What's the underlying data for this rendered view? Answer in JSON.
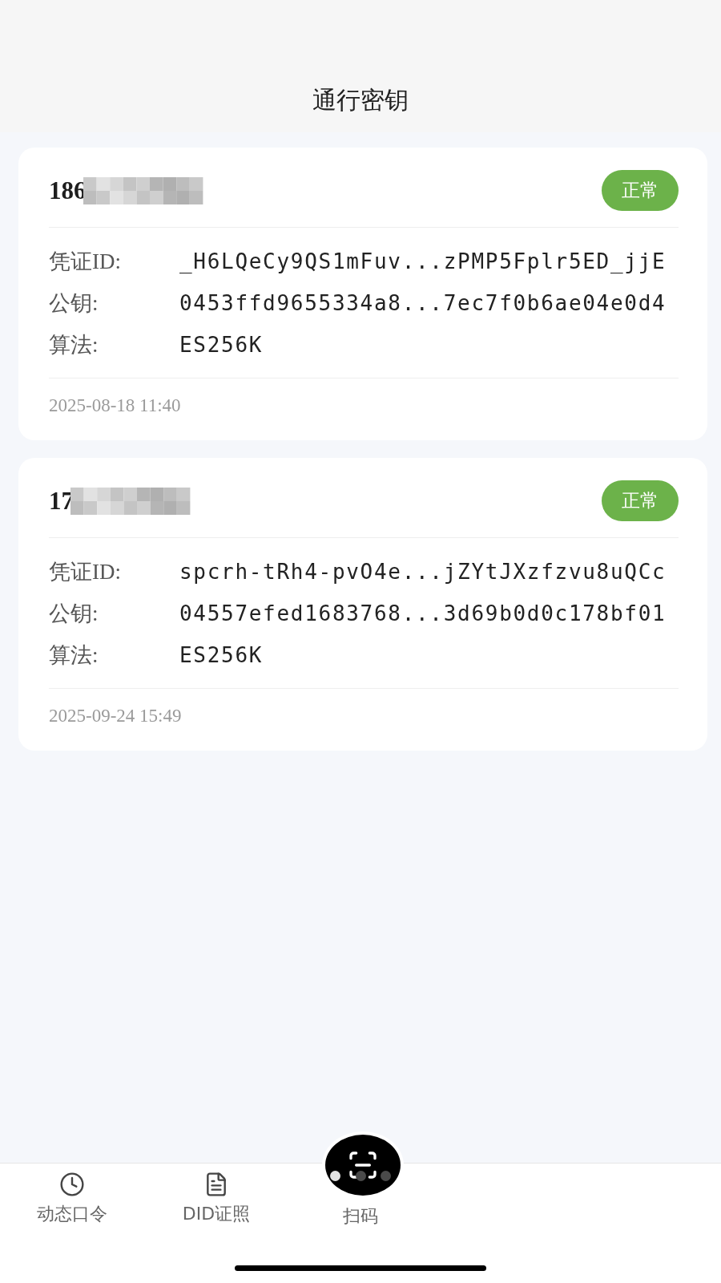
{
  "header": {
    "title": "通行密钥"
  },
  "credentials": [
    {
      "account": "186",
      "status": "正常",
      "fields": [
        {
          "label": "凭证ID:",
          "value": "_H6LQeCy9QS1mFuv...zPMP5Fplr5ED_jjE"
        },
        {
          "label": "公钥:",
          "value": "0453ffd9655334a8...7ec7f0b6ae04e0d4"
        },
        {
          "label": "算法:",
          "value": "ES256K"
        }
      ],
      "created": "2025-08-18 11:40"
    },
    {
      "account": "17",
      "status": "正常",
      "fields": [
        {
          "label": "凭证ID:",
          "value": "spcrh-tRh4-pvO4e...jZYtJXzfzvu8uQCc"
        },
        {
          "label": "公钥:",
          "value": "04557efed1683768...3d69b0d0c178bf01"
        },
        {
          "label": "算法:",
          "value": "ES256K"
        }
      ],
      "created": "2025-09-24 15:49"
    }
  ],
  "tab_bar": {
    "tabs": [
      {
        "kind": "tab",
        "label": "动态口令"
      },
      {
        "kind": "tab",
        "label": "DID证照"
      },
      {
        "kind": "scan",
        "label": "扫码"
      }
    ],
    "page_dots": [
      {
        "selected": true
      },
      {
        "selected": false
      },
      {
        "selected": false
      }
    ]
  }
}
